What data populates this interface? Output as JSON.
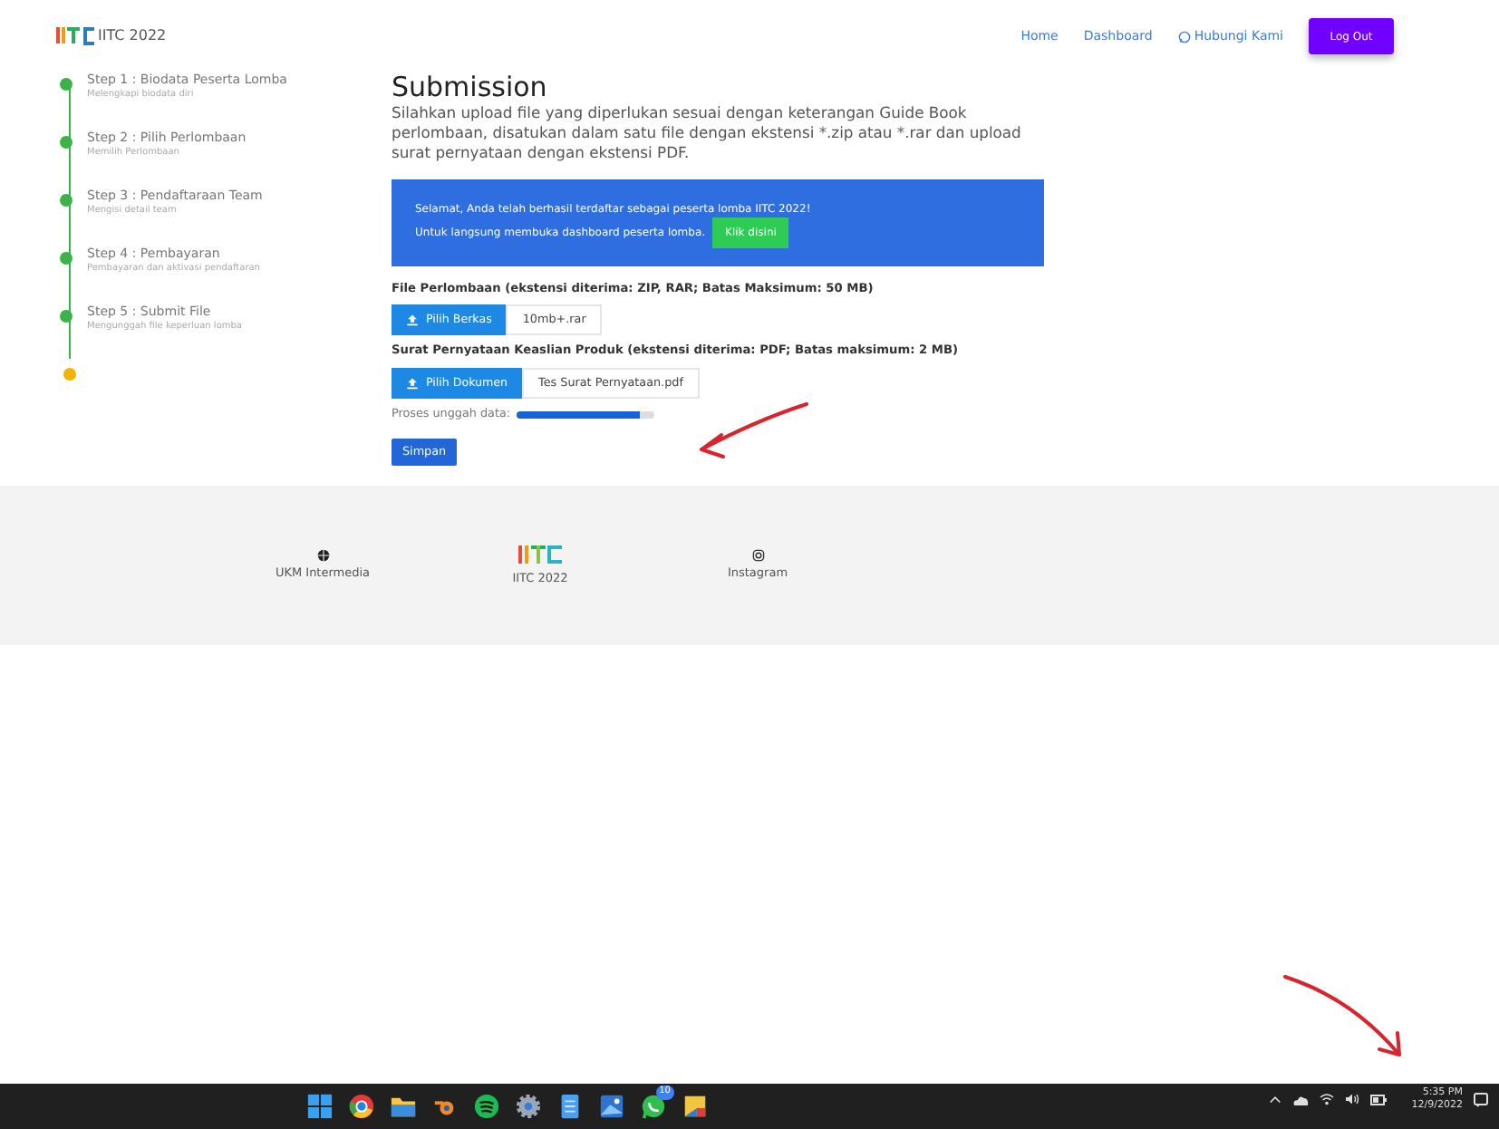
{
  "navbar": {
    "brand": "IITC 2022",
    "links": [
      {
        "label": "Home",
        "icon": false
      },
      {
        "label": "Dashboard",
        "icon": false
      },
      {
        "label": "Hubungi Kami",
        "icon": true
      }
    ],
    "logout": "Log Out"
  },
  "steps": [
    {
      "title": "Step 1 : Biodata Peserta Lomba",
      "subtitle": "Melengkapi biodata diri",
      "done": true
    },
    {
      "title": "Step 2 : Pilih Perlombaan",
      "subtitle": "Memilih Perlombaan",
      "done": true
    },
    {
      "title": "Step 3 : Pendaftaraan Team",
      "subtitle": "Mengisi detail team",
      "done": true
    },
    {
      "title": "Step 4 : Pembayaran",
      "subtitle": "Pembayaran dan aktivasi pendaftaran",
      "done": true
    },
    {
      "title": "Step 5 : Submit File",
      "subtitle": "Mengunggah file keperluan lomba",
      "done": true
    }
  ],
  "submission": {
    "title": "Submission",
    "description": "Silahkan upload file yang diperlukan sesuai dengan keterangan Guide Book perlombaan, disatukan dalam satu file dengan ekstensi *.zip atau *.rar dan upload surat pernyataan dengan ekstensi PDF.",
    "alert": {
      "line_1": "Selamat, Anda telah berhasil terdaftar sebagai peserta lomba IITC 2022!",
      "line_2": "Untuk langsung membuka dashboard peserta lomba.",
      "button": "Klik disini"
    },
    "uploads": [
      {
        "label": "File Perlombaan (ekstensi diterima: ZIP, RAR; Batas Maksimum: 50 MB)",
        "button": "Pilih Berkas",
        "file": "10mb+.rar"
      },
      {
        "label": "Surat Pernyataan Keaslian Produk (ekstensi diterima: PDF; Batas maksimum: 2 MB)",
        "button": "Pilih Dokumen",
        "file": "Tes Surat Pernyataan.pdf"
      }
    ],
    "progress": {
      "label": "Proses unggah data:",
      "level": 0.9
    },
    "save": "Simpan"
  },
  "footer": [
    {
      "kind": "globe",
      "label": "UKM Intermedia"
    },
    {
      "kind": "logo",
      "label": "IITC 2022"
    },
    {
      "kind": "instagram",
      "label": "Instagram"
    }
  ],
  "taskbar": {
    "apps": [
      {
        "kind": "start"
      },
      {
        "kind": "browser"
      },
      {
        "kind": "folder"
      },
      {
        "kind": "blender"
      },
      {
        "kind": "music"
      },
      {
        "kind": "gear"
      },
      {
        "kind": "notepad"
      },
      {
        "kind": "photos"
      },
      {
        "kind": "chat",
        "badge": "10"
      },
      {
        "kind": "paint"
      }
    ],
    "time": "5:35 PM",
    "date": "12/9/2022"
  }
}
